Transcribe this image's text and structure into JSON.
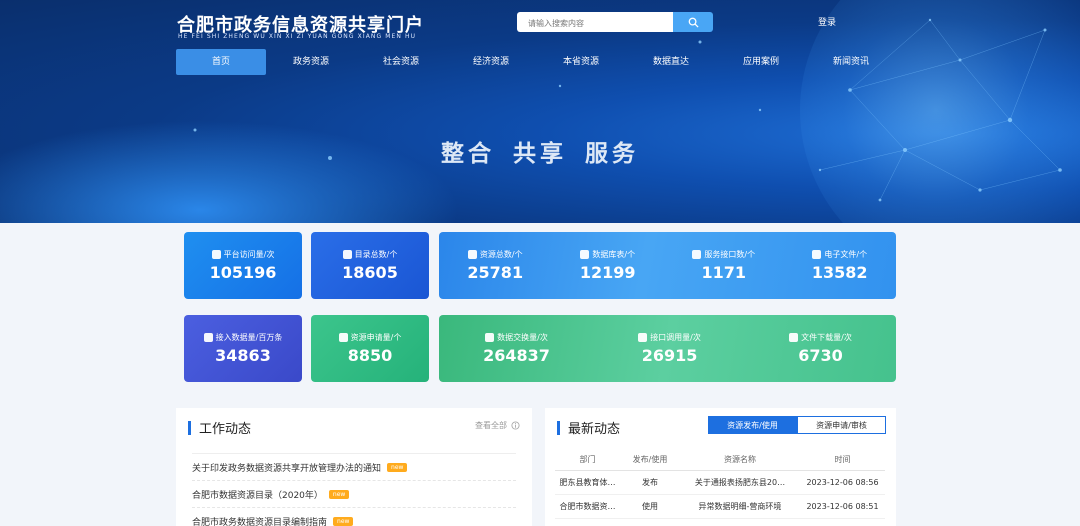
{
  "header": {
    "title_cn": "合肥市政务信息资源共享门户",
    "title_en": "HE FEI SHI ZHENG WU XIN XI ZI YUAN GONG XIANG MEN HU",
    "search_placeholder": "请输入搜索内容",
    "login": "登录"
  },
  "nav": [
    "首页",
    "政务资源",
    "社会资源",
    "经济资源",
    "本省资源",
    "数据直达",
    "应用案例",
    "新闻资讯"
  ],
  "slogan": "整合 共享 服务",
  "stats": {
    "visits": {
      "label": "平台访问量/次",
      "value": "105196"
    },
    "catalog": {
      "label": "目录总数/个",
      "value": "18605"
    },
    "resources": {
      "label": "资源总数/个",
      "value": "25781"
    },
    "db_tables": {
      "label": "数据库表/个",
      "value": "12199"
    },
    "api": {
      "label": "服务接口数/个",
      "value": "1171"
    },
    "files": {
      "label": "电子文件/个",
      "value": "13582"
    },
    "access": {
      "label": "接入数据量/百万条",
      "value": "34863"
    },
    "apply": {
      "label": "资源申请量/个",
      "value": "8850"
    },
    "exchange": {
      "label": "数据交换量/次",
      "value": "264837"
    },
    "calls": {
      "label": "接口调用量/次",
      "value": "26915"
    },
    "downloads": {
      "label": "文件下载量/次",
      "value": "6730"
    }
  },
  "work": {
    "title": "工作动态",
    "more": "查看全部",
    "new_badge": "new",
    "items": [
      "关于印发政务数据资源共享开放管理办法的通知",
      "合肥市数据资源目录（2020年）",
      "合肥市政务数据资源目录编制指南"
    ]
  },
  "latest": {
    "title": "最新动态",
    "tabs": [
      "资源发布/使用",
      "资源申请/审核"
    ],
    "columns": [
      "部门",
      "发布/使用",
      "资源名称",
      "时间"
    ],
    "rows": [
      [
        "肥东县教育体…",
        "发布",
        "关于通报表扬肥东县20…",
        "2023-12-06 08:56"
      ],
      [
        "合肥市数据资…",
        "使用",
        "异常数据明细-营商环境",
        "2023-12-06 08:51"
      ]
    ]
  }
}
